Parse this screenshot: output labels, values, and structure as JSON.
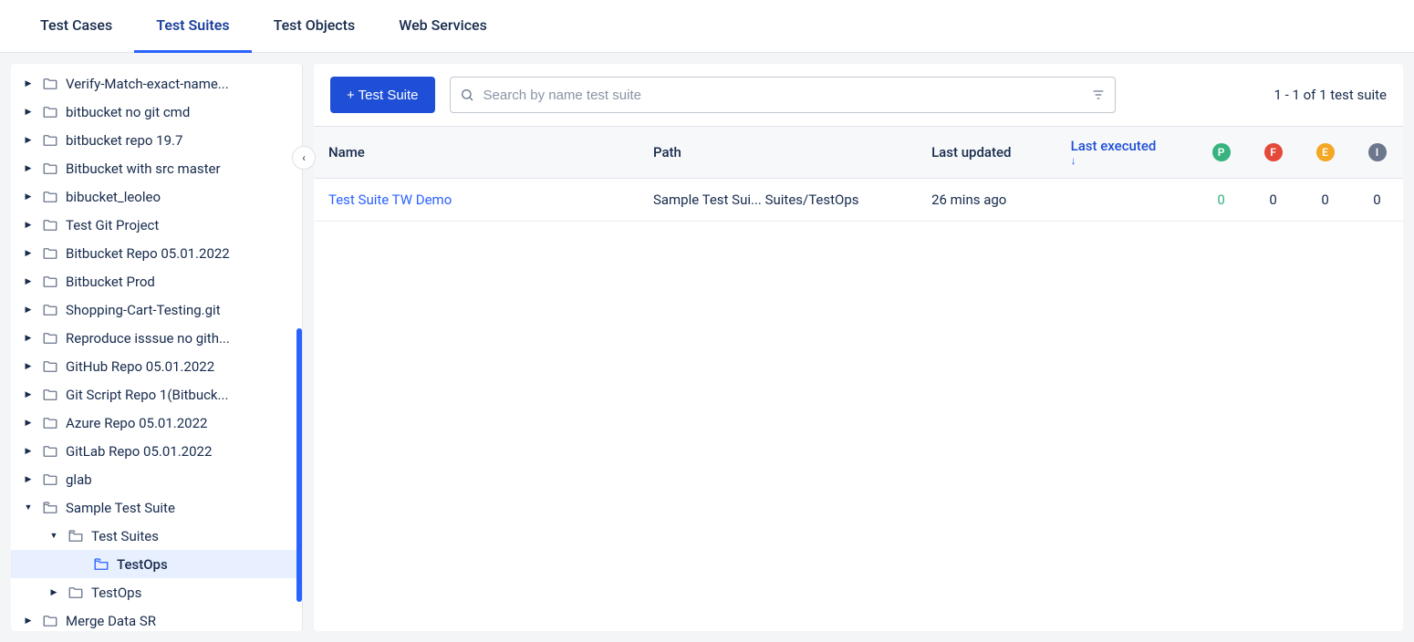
{
  "tabs": [
    {
      "label": "Test Cases",
      "active": false
    },
    {
      "label": "Test Suites",
      "active": true
    },
    {
      "label": "Test Objects",
      "active": false
    },
    {
      "label": "Web Services",
      "active": false
    }
  ],
  "sidebar": {
    "items": [
      {
        "label": "Verify-Match-exact-name...",
        "depth": 0,
        "caret": "right",
        "open": false
      },
      {
        "label": "bitbucket no git cmd",
        "depth": 0,
        "caret": "right",
        "open": false
      },
      {
        "label": "bitbucket repo 19.7",
        "depth": 0,
        "caret": "right",
        "open": false
      },
      {
        "label": "Bitbucket with src master",
        "depth": 0,
        "caret": "right",
        "open": false
      },
      {
        "label": "bibucket_leoleo",
        "depth": 0,
        "caret": "right",
        "open": false
      },
      {
        "label": "Test Git Project",
        "depth": 0,
        "caret": "right",
        "open": false
      },
      {
        "label": "Bitbucket Repo 05.01.2022",
        "depth": 0,
        "caret": "right",
        "open": false
      },
      {
        "label": "Bitbucket Prod",
        "depth": 0,
        "caret": "right",
        "open": false
      },
      {
        "label": "Shopping-Cart-Testing.git",
        "depth": 0,
        "caret": "right",
        "open": false
      },
      {
        "label": "Reproduce isssue no gith...",
        "depth": 0,
        "caret": "right",
        "open": false
      },
      {
        "label": "GitHub Repo 05.01.2022",
        "depth": 0,
        "caret": "right",
        "open": false
      },
      {
        "label": "Git Script Repo 1(Bitbuck...",
        "depth": 0,
        "caret": "right",
        "open": false
      },
      {
        "label": "Azure Repo 05.01.2022",
        "depth": 0,
        "caret": "right",
        "open": false
      },
      {
        "label": "GitLab Repo 05.01.2022",
        "depth": 0,
        "caret": "right",
        "open": false
      },
      {
        "label": "glab",
        "depth": 0,
        "caret": "right",
        "open": false
      },
      {
        "label": "Sample Test Suite",
        "depth": 0,
        "caret": "down",
        "open": true
      },
      {
        "label": "Test Suites",
        "depth": 1,
        "caret": "down",
        "open": true
      },
      {
        "label": "TestOps",
        "depth": 2,
        "caret": "none",
        "open": true,
        "selected": true
      },
      {
        "label": "TestOps",
        "depth": 1,
        "caret": "right",
        "open": false
      },
      {
        "label": "Merge Data SR",
        "depth": 0,
        "caret": "right",
        "open": false
      }
    ]
  },
  "toolbar": {
    "add_label": "+ Test Suite",
    "search_placeholder": "Search by name test suite",
    "pager": "1 - 1 of 1 test suite"
  },
  "table": {
    "headers": {
      "name": "Name",
      "path": "Path",
      "last_updated": "Last updated",
      "last_executed": "Last executed",
      "p": "P",
      "f": "F",
      "e": "E",
      "i": "I"
    },
    "rows": [
      {
        "name": "Test Suite TW Demo",
        "path": "Sample Test Sui... Suites/TestOps",
        "last_updated": "26 mins ago",
        "last_executed": "",
        "p": "0",
        "f": "0",
        "e": "0",
        "i": "0"
      }
    ]
  }
}
